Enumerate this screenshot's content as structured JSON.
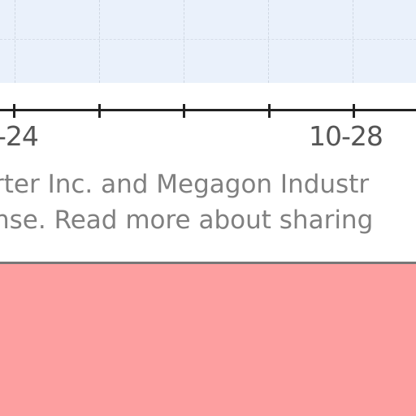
{
  "axis": {
    "tick_labels": [
      "-24",
      "10-28"
    ]
  },
  "footer": {
    "line1": "rter Inc. and Megagon Industr",
    "line2": "nse. Read more about sharing"
  },
  "colors": {
    "plot_background": "#eaf1fb",
    "panel_pink": "#fd9fa0",
    "axis": "#222222",
    "caption_text": "#808080"
  }
}
